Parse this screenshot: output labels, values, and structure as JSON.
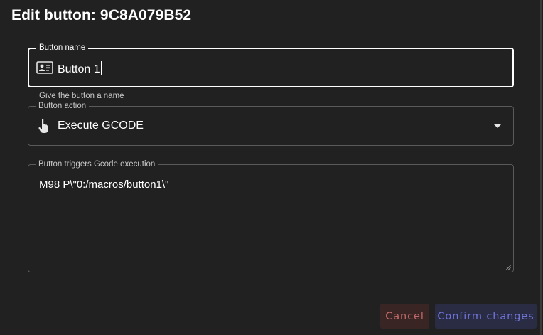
{
  "dialog": {
    "title": "Edit button: 9C8A079B52"
  },
  "name_field": {
    "legend": "Button name",
    "value": "Button 1",
    "hint": "Give the button a name",
    "icon": "id-card-icon"
  },
  "action_field": {
    "legend": "Button action",
    "value": "Execute GCODE",
    "icon": "pointing-hand-icon"
  },
  "gcode_field": {
    "legend": "Button triggers Gcode execution",
    "value": "M98 P\\\"0:/macros/button1\\\""
  },
  "actions": {
    "cancel_label": "Cancel",
    "confirm_label": "Confirm changes"
  },
  "colors": {
    "background": "#212121",
    "cancel_text": "#c06a6a",
    "confirm_text": "#6f74d8"
  }
}
